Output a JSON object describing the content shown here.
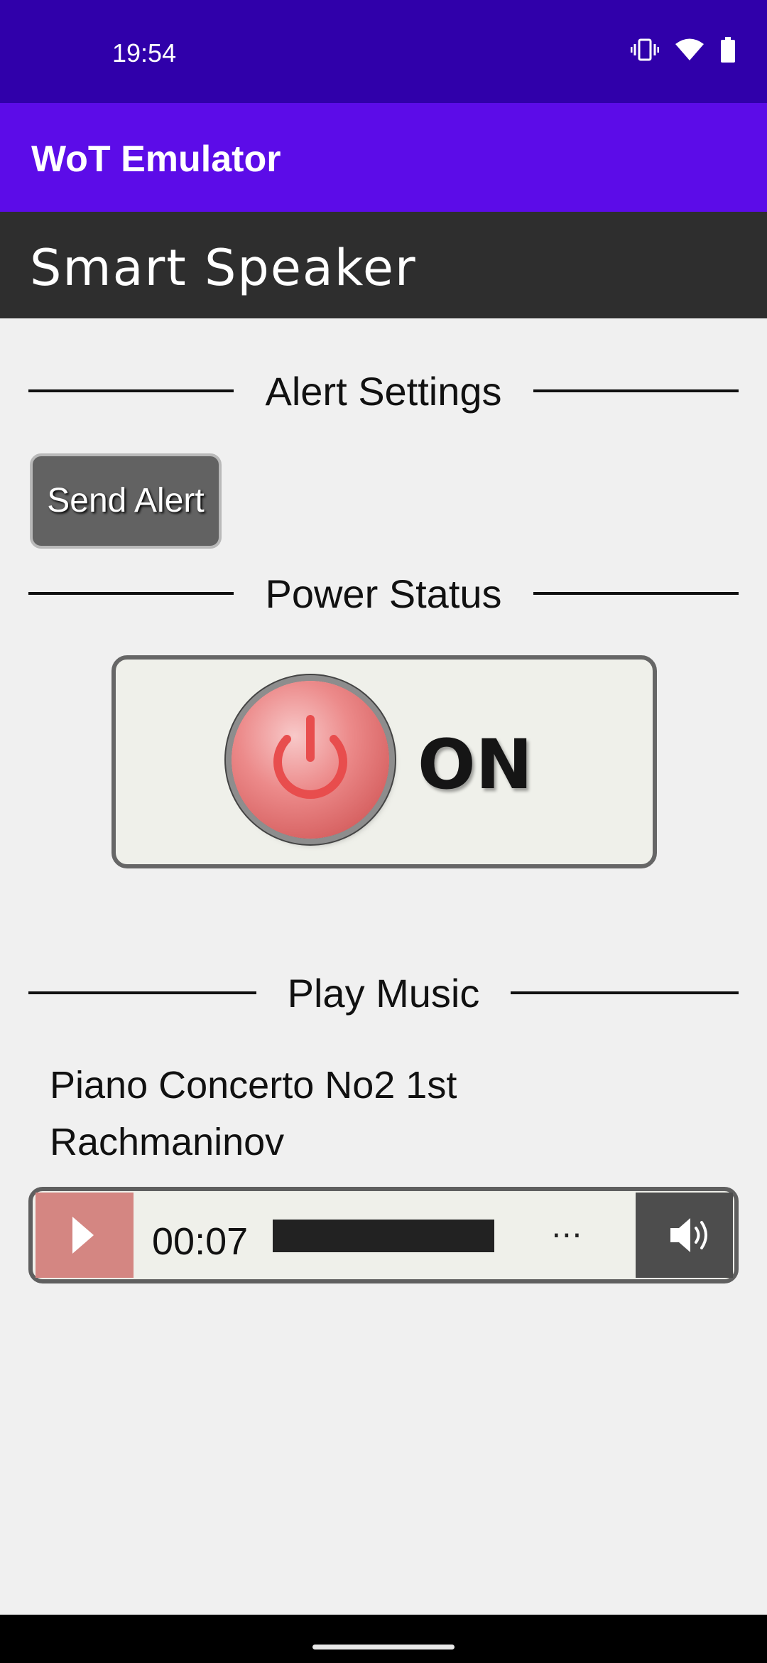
{
  "status_bar": {
    "time": "19:54"
  },
  "app_bar": {
    "title": "WoT Emulator"
  },
  "page": {
    "title": "Smart Speaker"
  },
  "sections": {
    "alert": "Alert Settings",
    "power": "Power Status",
    "music": "Play Music"
  },
  "alert": {
    "button_label": "Send Alert"
  },
  "power": {
    "state_label": "ON"
  },
  "music": {
    "track_title": "Piano Concerto No2 1st",
    "artist": "Rachmaninov",
    "current_time": "00:07",
    "more_label": "⋯"
  },
  "colors": {
    "status_bar": "#3000aa",
    "app_bar": "#5c0ce8",
    "page_header": "#2e2e2e",
    "play_button": "#d48682"
  },
  "icons": [
    "vibrate-icon",
    "wifi-icon",
    "battery-icon",
    "power-icon",
    "play-icon",
    "volume-icon"
  ]
}
